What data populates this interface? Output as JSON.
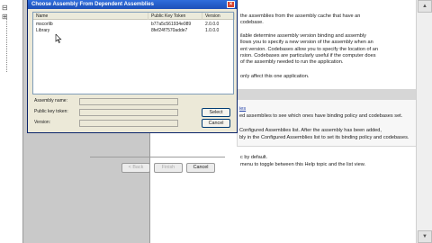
{
  "dialog": {
    "title": "Choose Assembly From Dependent Assemblies",
    "columns": [
      "Name",
      "Public Key Token",
      "Version"
    ],
    "rows": [
      {
        "name": "mscorlib",
        "token": "b77a5c561934e089",
        "version": "2.0.0.0"
      },
      {
        "name": "Library",
        "token": "8fef24f7570adde7",
        "version": "1.0.0.0"
      }
    ],
    "fields": [
      {
        "label": "Assembly name:",
        "value": ""
      },
      {
        "label": "Public key token:",
        "value": ""
      },
      {
        "label": "Version:",
        "value": ""
      }
    ],
    "select_label": "Select",
    "cancel_label": "Cancel"
  },
  "help": {
    "lines": [
      "the assemblies from the assembly cache that have an",
      "codebase.",
      "ilable determine assembly version binding and assembly",
      "llows you to specify a new version of the assembly when an",
      "ent version.  Codebases allow you to specify the location of an",
      "rsion. Codebases are particularly useful if the computer does",
      "of the assembly needed to run the application.",
      "only affect this one application."
    ],
    "box_lines": [
      "ies",
      "ed assemblies to see which ones have binding policy and codebases set.",
      "Configured Assemblies list. After the assembly has been added,",
      "bly in the Configured Assemblies list to set its binding policy and codebases."
    ],
    "bottom_lines": [
      "c by default.",
      "menu to toggle between this Help topic and the list view."
    ]
  },
  "wizard": {
    "back_label": "< Back",
    "finish_label": "Finish",
    "cancel_label": "Cancel"
  },
  "colors": {
    "title_bar": "#1c4fb8",
    "dialog_bg": "#ece9d8",
    "link": "#1f3fa8"
  }
}
